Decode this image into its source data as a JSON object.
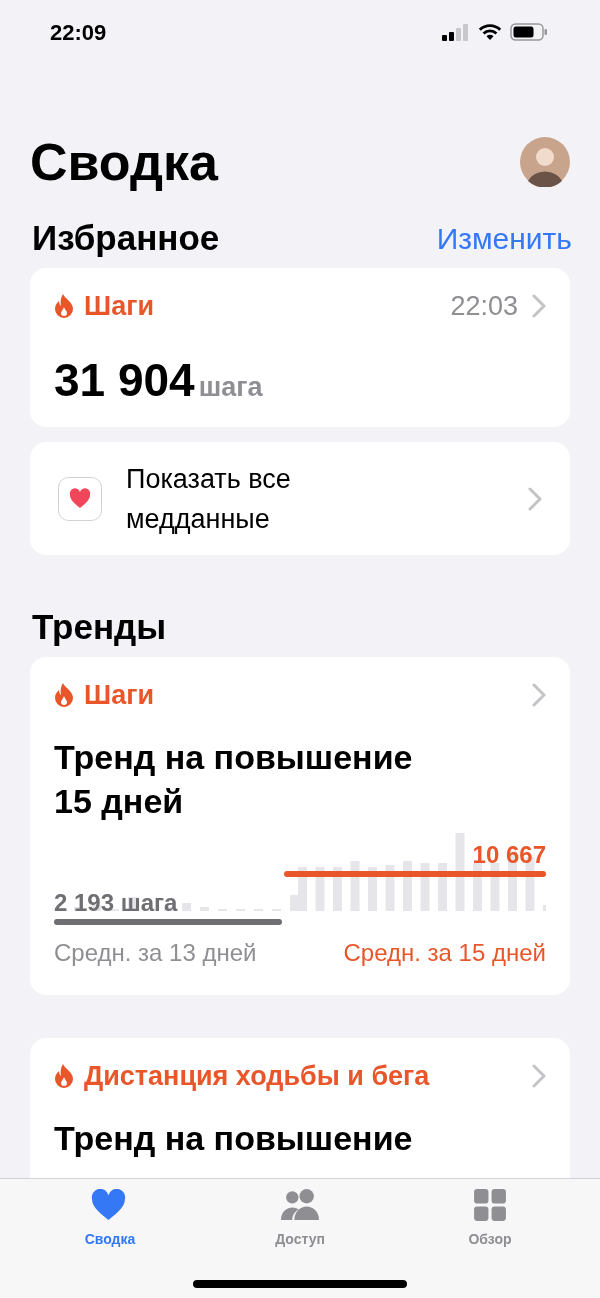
{
  "status_bar": {
    "time": "22:09"
  },
  "header": {
    "title": "Сводка"
  },
  "favorites": {
    "title": "Избранное",
    "edit_link": "Изменить",
    "cards": [
      {
        "kind": "metric",
        "title": "Шаги",
        "time": "22:03",
        "value": "31 904",
        "unit": "шага"
      },
      {
        "kind": "link",
        "label": "Показать все медданные"
      }
    ]
  },
  "trends": {
    "title": "Тренды",
    "cards": [
      {
        "title": "Шаги",
        "headline": "Тренд на повышение 15 дней",
        "previous_value": "2 193 шага",
        "current_value": "10 667",
        "previous_caption": "Средн. за 13 дней",
        "current_caption": "Средн. за 15 дней"
      },
      {
        "title": "Дистанция ходьбы и бега",
        "headline": "Тренд на повышение"
      }
    ]
  },
  "tab_bar": [
    {
      "label": "Сводка",
      "selected": true
    },
    {
      "label": "Доступ",
      "selected": false
    },
    {
      "label": "Обзор",
      "selected": false
    }
  ]
}
